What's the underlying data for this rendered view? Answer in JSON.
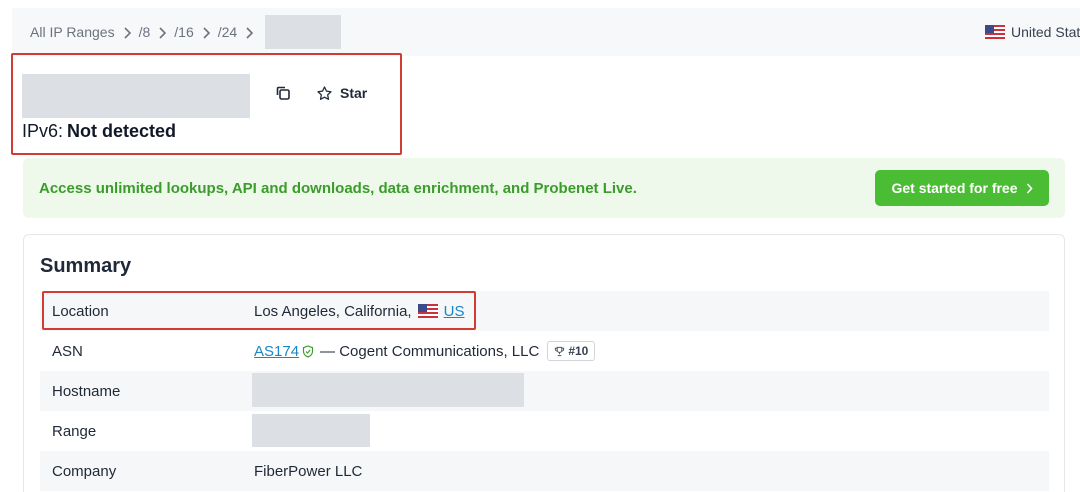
{
  "breadcrumb": {
    "items": [
      "All IP Ranges",
      "/8",
      "/16",
      "/24"
    ]
  },
  "country_selector": {
    "label": "United States"
  },
  "ip_header": {
    "copy_icon": "copy-icon",
    "star_label": "Star",
    "ipv6_label": "IPv6:",
    "ipv6_value": "Not detected"
  },
  "promo": {
    "text": "Access unlimited lookups, API and downloads, data enrichment, and Probenet Live.",
    "button_label": "Get started for free"
  },
  "summary": {
    "title": "Summary",
    "location": {
      "label": "Location",
      "value": "Los Angeles, California,",
      "country_code": "US"
    },
    "asn": {
      "label": "ASN",
      "link": "AS174",
      "org": "— Cogent Communications, LLC",
      "rank": "#10"
    },
    "hostname": {
      "label": "Hostname"
    },
    "range": {
      "label": "Range"
    },
    "company": {
      "label": "Company",
      "value": "FiberPower LLC"
    }
  },
  "colors": {
    "highlight_box": "#d13b34",
    "promo_green": "#3a9d2a",
    "button_green": "#4bbd34",
    "link_blue": "#1a86c7"
  }
}
